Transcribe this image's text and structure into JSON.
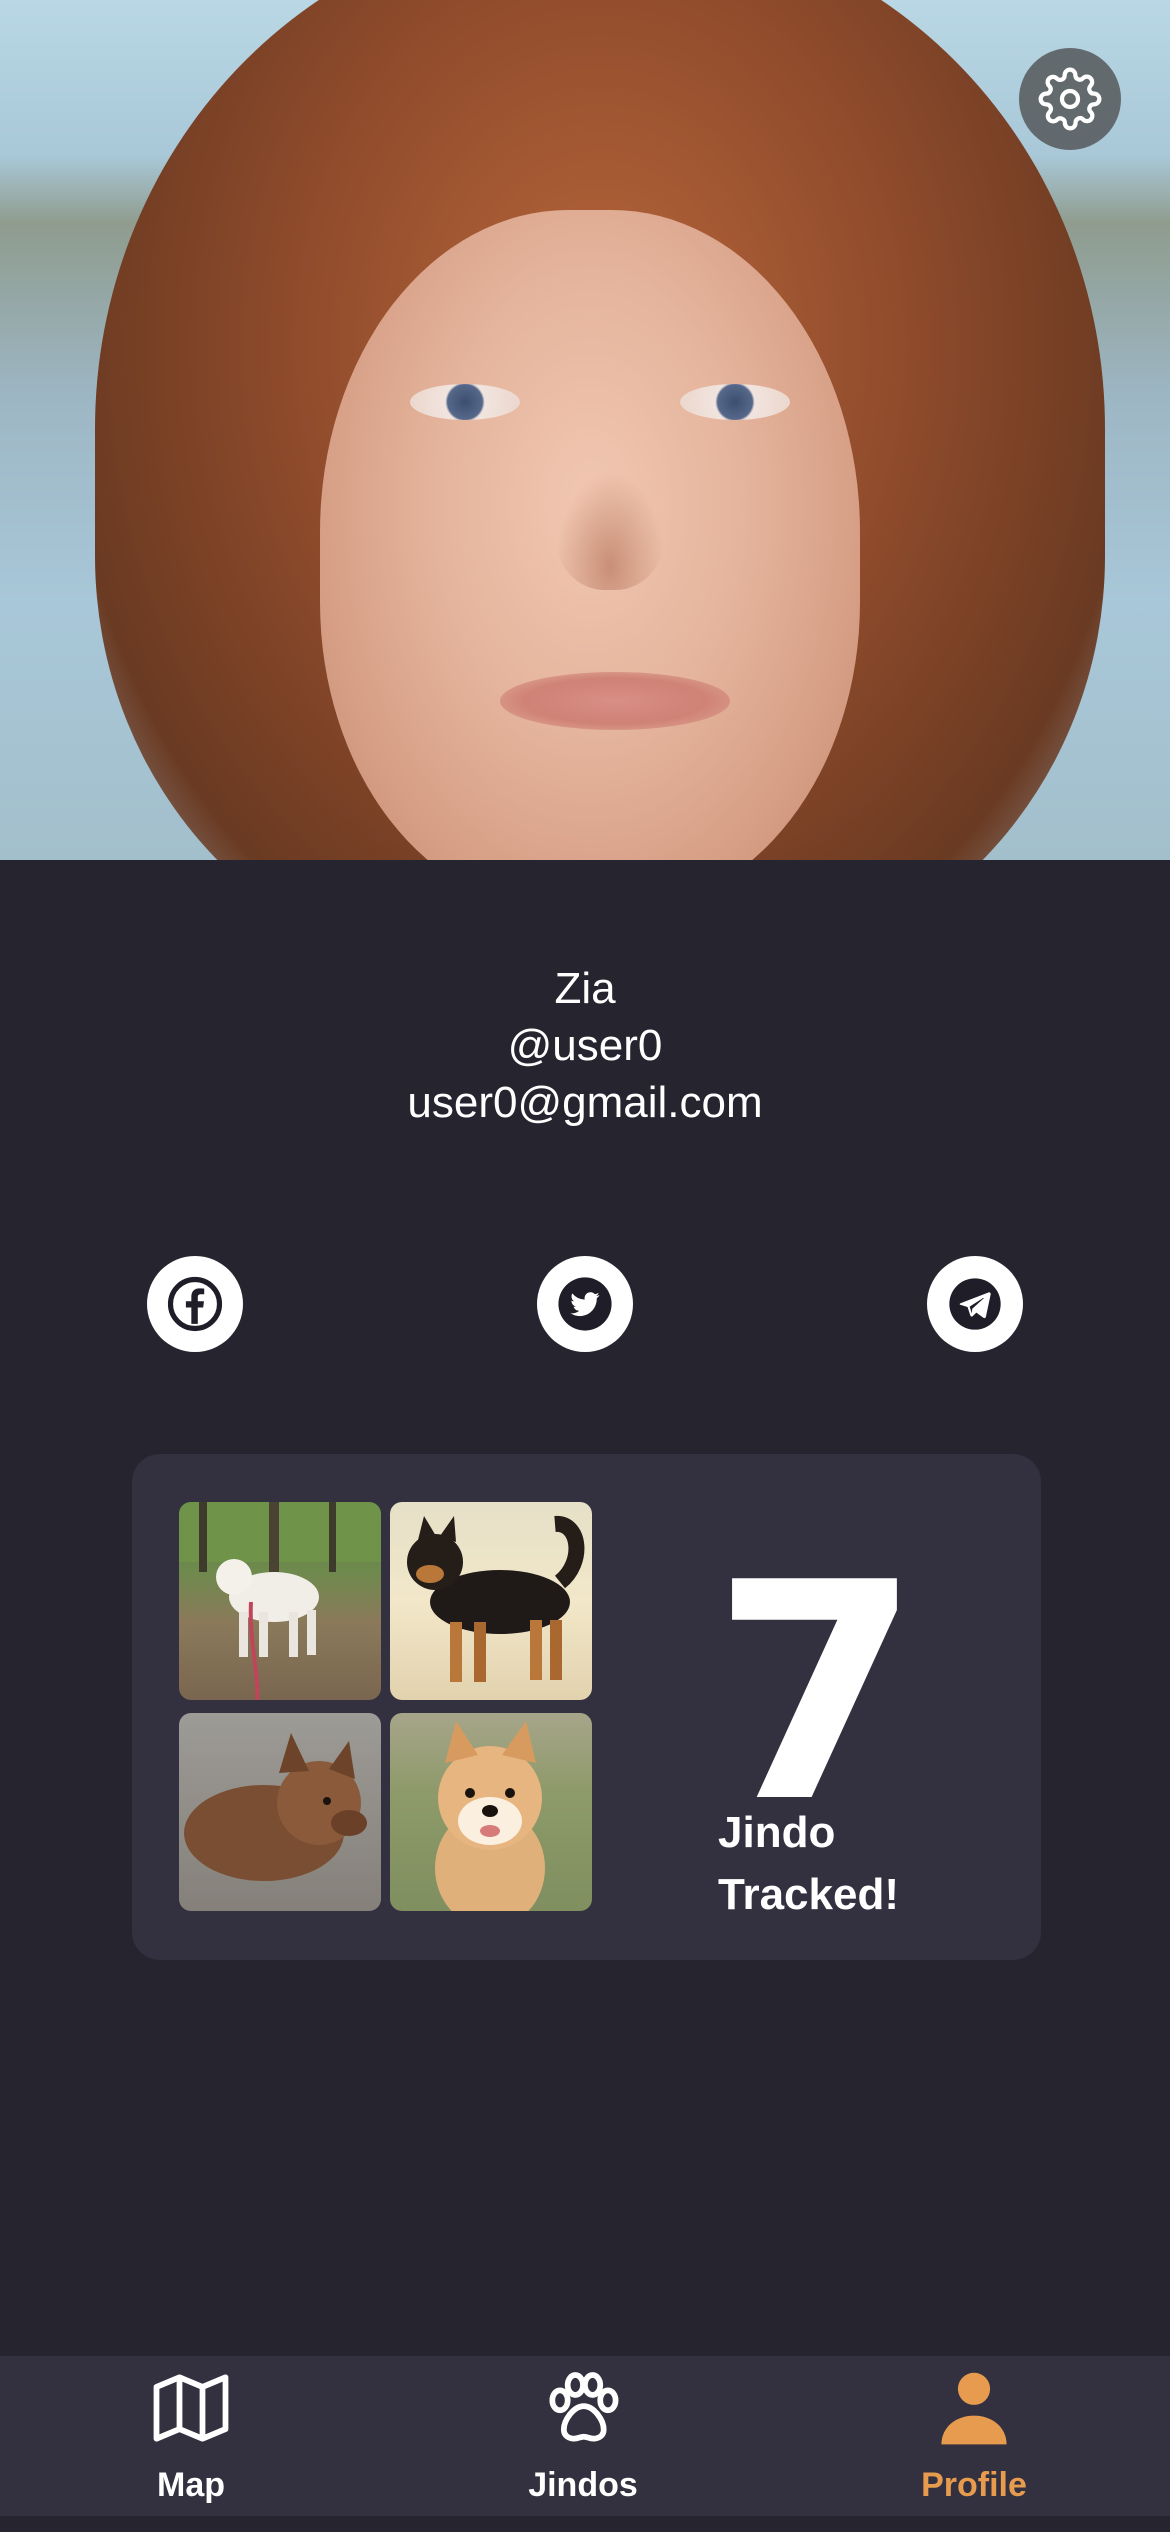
{
  "profile": {
    "name": "Zia",
    "username": "@user0",
    "email": "user0@gmail.com"
  },
  "social": [
    {
      "icon": "facebook-icon"
    },
    {
      "icon": "twitter-icon"
    },
    {
      "icon": "telegram-icon"
    }
  ],
  "stats": {
    "count": "7",
    "label_line1": "Jindo",
    "label_line2": "Tracked!"
  },
  "tabs": [
    {
      "label": "Map",
      "icon": "map-icon"
    },
    {
      "label": "Jindos",
      "icon": "paw-icon"
    },
    {
      "label": "Profile",
      "icon": "person-icon",
      "active": true
    }
  ],
  "colors": {
    "background": "#26242f",
    "card": "#33313f",
    "accent": "#e79b4e",
    "text": "#ffffff"
  }
}
